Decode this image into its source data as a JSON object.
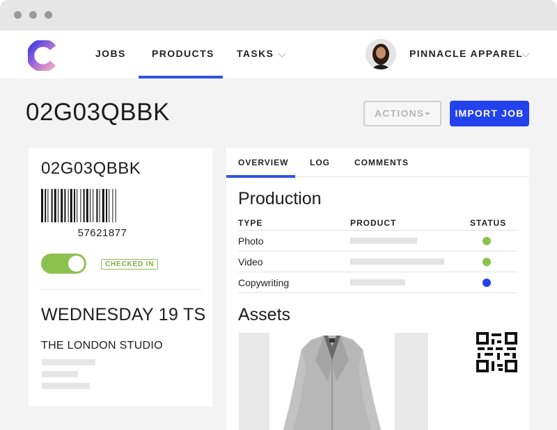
{
  "navbar": {
    "items": [
      {
        "label": "JOBS"
      },
      {
        "label": "PRODUCTS"
      },
      {
        "label": "TASKS"
      }
    ],
    "account_name": "PINNACLE APPAREL"
  },
  "page": {
    "title": "02G03QBBK",
    "actions_label": "ACTIONS",
    "import_label": "IMPORT JOB"
  },
  "left_card": {
    "code": "02G03QBBK",
    "barcode_number": "57621877",
    "checked_in": true,
    "badge": "CHECKED IN",
    "date": "WEDNESDAY 19 TS",
    "studio": "THE LONDON STUDIO"
  },
  "right_card": {
    "tabs": [
      {
        "label": "OVERVIEW"
      },
      {
        "label": "LOG"
      },
      {
        "label": "COMMENTS"
      }
    ],
    "production_title": "Production",
    "columns": [
      "TYPE",
      "PRODUCT",
      "STATUS"
    ],
    "rows": [
      {
        "type": "Photo",
        "status_color": "#8cc14f"
      },
      {
        "type": "Video",
        "status_color": "#8cc14f"
      },
      {
        "type": "Copywriting",
        "status_color": "#2342ee"
      }
    ],
    "assets_title": "Assets"
  },
  "colors": {
    "accent": "#2f55e6",
    "primary_button": "#2342ee",
    "success": "#8cc14f"
  },
  "icons": [
    "app-logo-icon",
    "chevron-down-icon",
    "caret-down-icon",
    "qr-code-icon"
  ]
}
